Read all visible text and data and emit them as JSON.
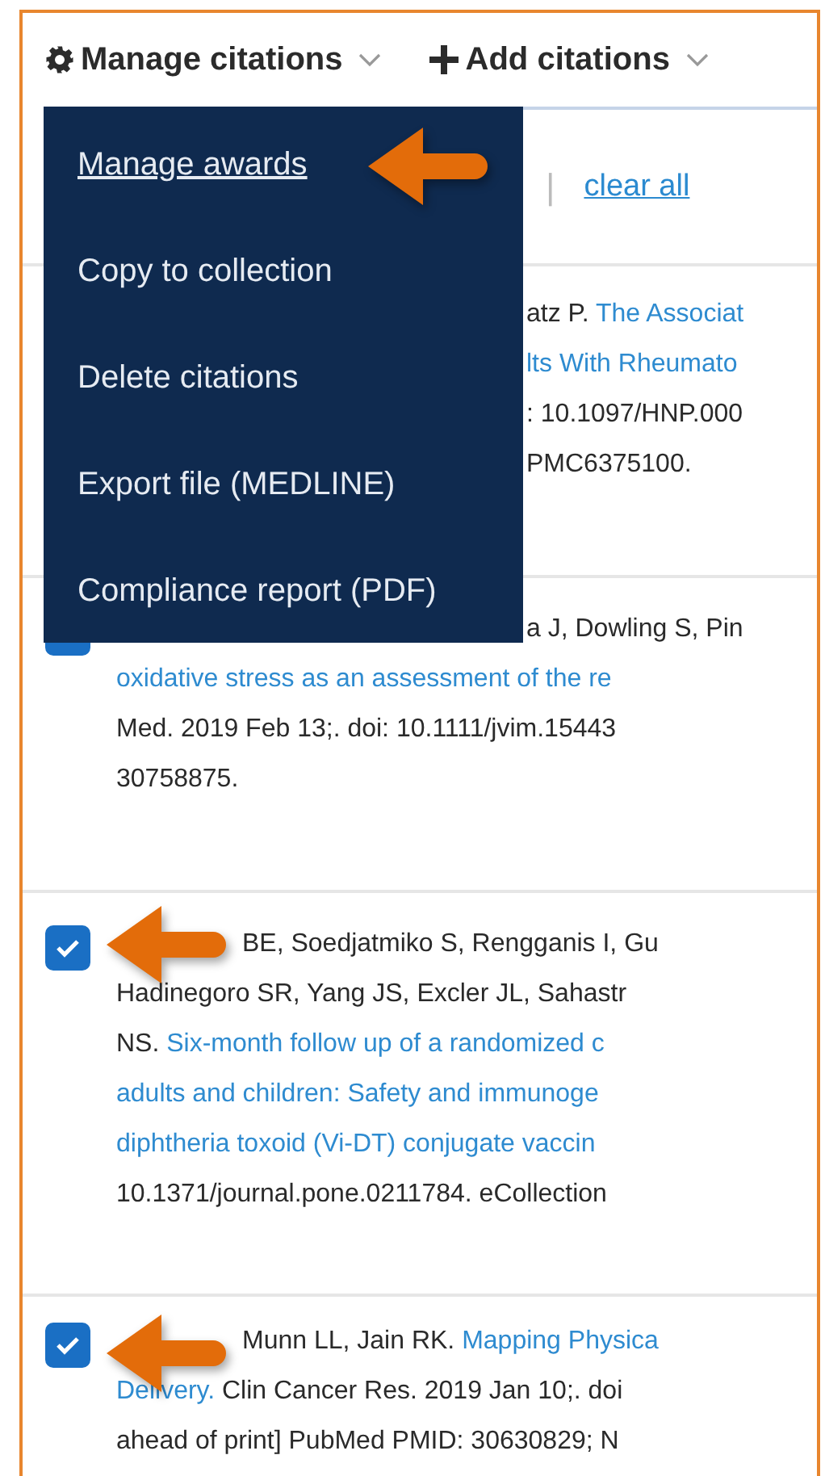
{
  "toolbar": [
    {
      "label": "Manage citations",
      "kind": "gear"
    },
    {
      "label": "Add citations",
      "kind": "plus"
    }
  ],
  "menu": {
    "items": [
      {
        "label": "Manage awards",
        "selected": true
      },
      {
        "label": "Copy to collection",
        "selected": false
      },
      {
        "label": "Delete citations",
        "selected": false
      },
      {
        "label": "Export file (MEDLINE)",
        "selected": false
      },
      {
        "label": "Compliance report (PDF)",
        "selected": false
      }
    ]
  },
  "selection": {
    "separator": "|",
    "clear_link": "clear all"
  },
  "citations": [
    {
      "lines": [
        {
          "kind": "after_menu",
          "segments": [
            {
              "text": "atz P. ",
              "kind": "text"
            },
            {
              "text": "The Associat",
              "kind": "link"
            }
          ]
        },
        {
          "kind": "after_menu",
          "segments": [
            {
              "text": "lts With Rheumato",
              "kind": "link"
            }
          ]
        },
        {
          "kind": "after_menu",
          "segments": [
            {
              "text": ": 10.1097/HNP.000",
              "kind": "text"
            }
          ]
        },
        {
          "kind": "after_menu",
          "segments": [
            {
              "text": "PMC6375100.",
              "kind": "text"
            }
          ]
        }
      ]
    },
    {
      "checked": true,
      "lines": [
        {
          "kind": "after_menu",
          "segments": [
            {
              "text": "a J, Dowling S, Pin",
              "kind": "text"
            }
          ]
        },
        {
          "kind": "full",
          "segments": [
            {
              "text": "oxidative stress as an assessment of the re",
              "kind": "link"
            }
          ]
        },
        {
          "kind": "full",
          "segments": [
            {
              "text": "Med. 2019 Feb 13;. doi: 10.1111/jvim.15443",
              "kind": "text"
            }
          ]
        },
        {
          "kind": "full",
          "segments": [
            {
              "text": "30758875.",
              "kind": "text"
            }
          ]
        }
      ]
    },
    {
      "checked": true,
      "lines": [
        {
          "kind": "after_arrow",
          "segments": [
            {
              "text": "BE, Soedjatmiko S, Rengganis I, Gu",
              "kind": "text"
            }
          ]
        },
        {
          "kind": "full",
          "segments": [
            {
              "text": "Hadinegoro SR, Yang JS, Excler JL, Sahastr",
              "kind": "text"
            }
          ]
        },
        {
          "kind": "full",
          "segments": [
            {
              "text": "NS. ",
              "kind": "text"
            },
            {
              "text": "Six-month follow up of a randomized c",
              "kind": "link"
            }
          ]
        },
        {
          "kind": "full",
          "segments": [
            {
              "text": "adults and children: Safety and immunoge",
              "kind": "link"
            }
          ]
        },
        {
          "kind": "full",
          "segments": [
            {
              "text": "diphtheria toxoid (Vi-DT) conjugate vaccin",
              "kind": "link"
            }
          ]
        },
        {
          "kind": "full",
          "segments": [
            {
              "text": "10.1371/journal.pone.0211784. eCollection",
              "kind": "text"
            }
          ]
        }
      ]
    },
    {
      "checked": true,
      "lines": [
        {
          "kind": "after_arrow",
          "segments": [
            {
              "text": "Munn LL, Jain RK. ",
              "kind": "text"
            },
            {
              "text": "Mapping Physica",
              "kind": "link"
            }
          ]
        },
        {
          "kind": "full",
          "segments": [
            {
              "text": "Delivery.",
              "kind": "link"
            },
            {
              "text": " Clin Cancer Res. 2019 Jan 10;. doi",
              "kind": "text"
            }
          ]
        },
        {
          "kind": "full",
          "segments": [
            {
              "text": "ahead of print] PubMed PMID: 30630829; N",
              "kind": "text"
            }
          ]
        }
      ]
    }
  ]
}
